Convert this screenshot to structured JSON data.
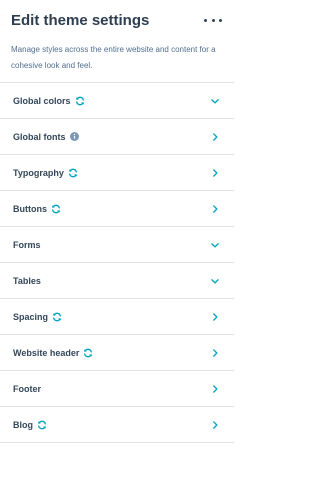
{
  "header": {
    "title": "Edit theme settings",
    "description": "Manage styles across the entire website and content for a cohesive look and feel.",
    "more_icon": "more-horizontal-icon"
  },
  "sections": [
    {
      "label": "Global colors",
      "badge": "sync-icon",
      "chevron": "chevron-down-icon"
    },
    {
      "label": "Global fonts",
      "badge": "info-icon",
      "chevron": "chevron-right-icon"
    },
    {
      "label": "Typography",
      "badge": "sync-icon",
      "chevron": "chevron-right-icon"
    },
    {
      "label": "Buttons",
      "badge": "sync-icon",
      "chevron": "chevron-right-icon"
    },
    {
      "label": "Forms",
      "badge": "",
      "chevron": "chevron-down-icon"
    },
    {
      "label": "Tables",
      "badge": "",
      "chevron": "chevron-down-icon"
    },
    {
      "label": "Spacing",
      "badge": "sync-icon",
      "chevron": "chevron-right-icon"
    },
    {
      "label": "Website header",
      "badge": "sync-icon",
      "chevron": "chevron-right-icon"
    },
    {
      "label": "Footer",
      "badge": "",
      "chevron": "chevron-right-icon"
    },
    {
      "label": "Blog",
      "badge": "sync-icon",
      "chevron": "chevron-right-icon"
    }
  ],
  "colors": {
    "title": "#2d3e50",
    "text": "#33475b",
    "muted": "#516f90",
    "accent": "#00a4bd",
    "info": "#7c98b6",
    "divider": "#dfe3eb"
  }
}
